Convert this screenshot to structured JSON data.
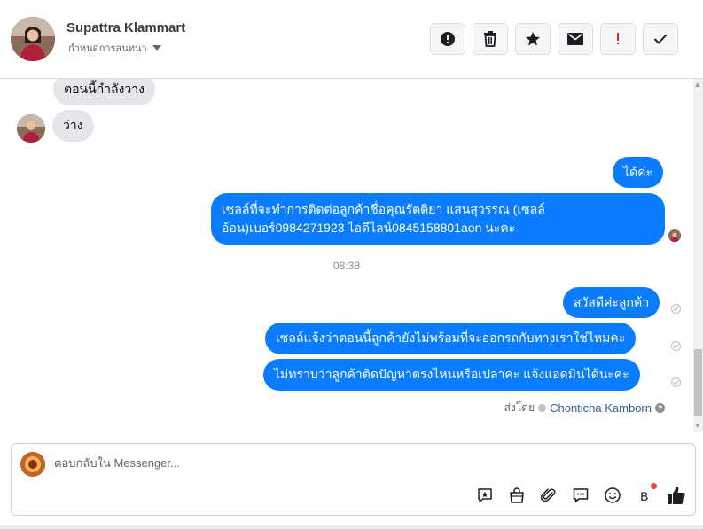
{
  "header": {
    "contact_name": "Supattra Klammart",
    "contact_subtitle": "กำหนดการสนทนา",
    "actions": [
      {
        "name": "report",
        "icon": "alert-circle-icon"
      },
      {
        "name": "delete",
        "icon": "trash-icon"
      },
      {
        "name": "star",
        "icon": "star-icon"
      },
      {
        "name": "mark-unread",
        "icon": "envelope-icon"
      },
      {
        "name": "spam",
        "icon": "exclamation-icon"
      },
      {
        "name": "done",
        "icon": "check-icon"
      }
    ]
  },
  "messages": {
    "incoming_1": "ตอนนี้กำลังวาง",
    "incoming_2": "ว่าง",
    "outgoing_1": "ได้ค่ะ",
    "outgoing_2_line1": "เซลล์ที่จะทำการติดต่อลูกค้าชื่อคุณรัตติยา แสนสุวรรณ (เซลล์",
    "outgoing_2_line2": "อ้อน)เบอร์0984271923 ไอดีไลน์0845158801aon นะคะ",
    "timestamp": "08:38",
    "outgoing_3": "สวัสดีค่ะลูกค้า",
    "outgoing_4": "เซลล์แจ้งว่าตอนนี้ลูกค้ายังไม่พร้อมที่จะออกรถกับทางเราใช่ไหมคะ",
    "outgoing_5": "ไม่ทราบว่าลูกค้าติดปัญหาตรงไหนหรือเปล่าคะ แจ้งแอดมินได้นะคะ"
  },
  "sent_by": {
    "label": "ส่งโดย",
    "name": "Chonticha Kamborn",
    "help": "?"
  },
  "composer": {
    "placeholder": "ตอบกลับใน Messenger...",
    "icons": [
      "saved-reply-icon",
      "shopping-bag-icon",
      "attachment-icon",
      "message-icon",
      "emoji-icon",
      "payment-icon",
      "like-icon"
    ]
  },
  "colors": {
    "outgoing_bubble": "#0a7cff",
    "incoming_bubble": "#e4e6eb",
    "sent_by_name": "#385898"
  }
}
